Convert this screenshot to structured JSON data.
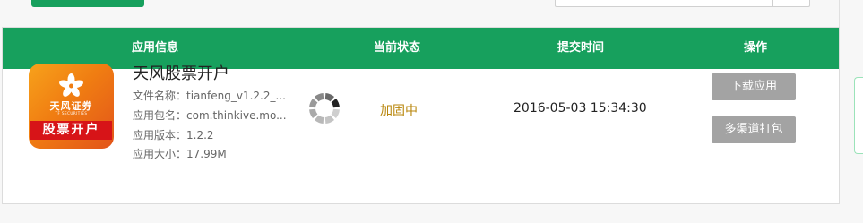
{
  "table": {
    "headers": {
      "info": "应用信息",
      "status": "当前状态",
      "time": "提交时间",
      "action": "操作"
    },
    "rows": [
      {
        "icon": {
          "brand": "天风证券",
          "brand_en": "TF SECURITIES",
          "ribbon": "股票开户"
        },
        "name": "天风股票开户",
        "file_name": "文件名称：tianfeng_v1.2.2_...",
        "package": "应用包名：com.thinkive.mo...",
        "version": "应用版本：1.2.2",
        "size": "应用大小：17.99M",
        "status": "加固中",
        "submit_time": "2016-05-03 15:34:30",
        "actions": {
          "download": "下载应用",
          "multi_channel": "多渠道打包"
        }
      }
    ]
  },
  "colors": {
    "header_green": "#17a05d",
    "status_text": "#b8860b",
    "button_gray": "#a3a3a3",
    "ribbon_red": "#d71418"
  },
  "icons": [
    "loading-spinner-icon",
    "flower-logo-icon",
    "search-icon"
  ]
}
